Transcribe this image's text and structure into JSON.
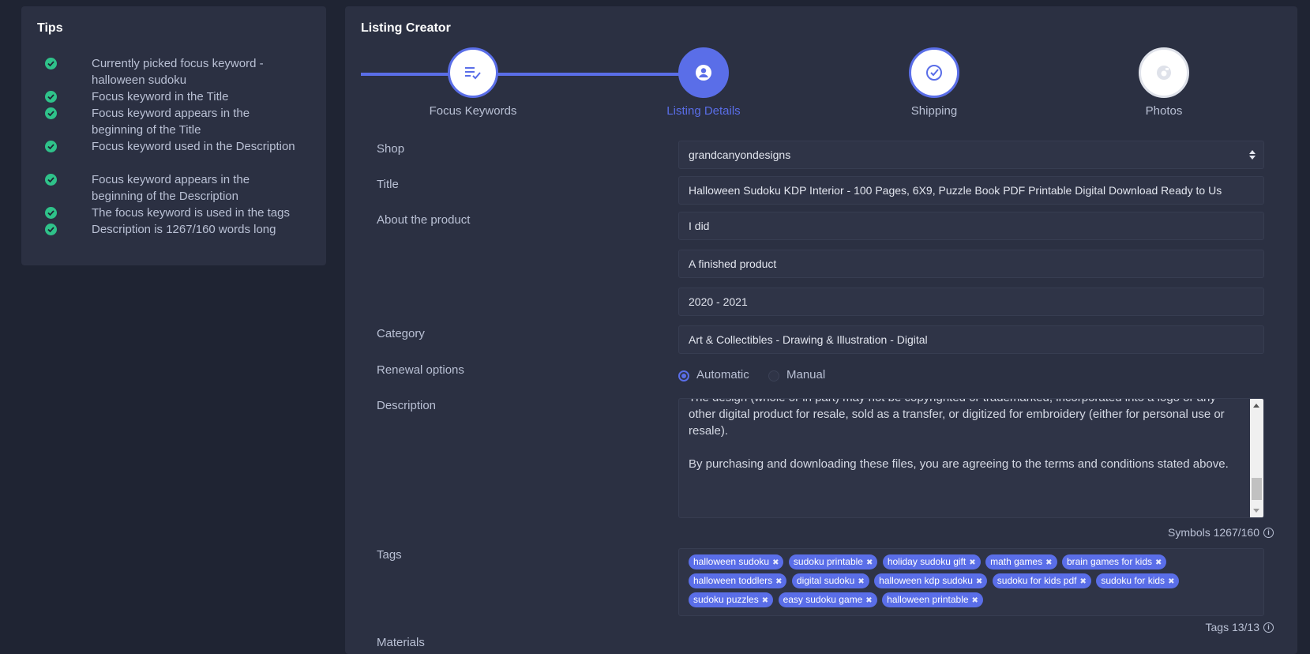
{
  "tips": {
    "title": "Tips",
    "items": [
      {
        "text": "Currently picked focus keyword - halloween sudoku",
        "status": "done"
      },
      {
        "text": "Focus keyword in the Title",
        "status": "done"
      },
      {
        "text": "Focus keyword appears in the beginning of the Title",
        "status": "done"
      },
      {
        "text": "Focus keyword used in the Description",
        "status": "done"
      },
      {
        "text": "Focus keyword appears in the beginning of the Description",
        "status": "done"
      },
      {
        "text": "The focus keyword is used in the tags",
        "status": "done"
      },
      {
        "text": "Description is 1267/160 words long",
        "status": "done"
      }
    ]
  },
  "listing": {
    "title": "Listing Creator",
    "steps": [
      {
        "label": "Focus Keywords",
        "icon": "list-check-icon",
        "state": "completed"
      },
      {
        "label": "Listing Details",
        "icon": "user-circle-icon",
        "state": "active"
      },
      {
        "label": "Shipping",
        "icon": "check-circle-icon",
        "state": "upcoming"
      },
      {
        "label": "Photos",
        "icon": "camera-icon",
        "state": "upcoming"
      }
    ],
    "fields": {
      "shop": {
        "label": "Shop",
        "value": "grandcanyondesigns"
      },
      "title": {
        "label": "Title",
        "value": "Halloween Sudoku KDP Interior - 100 Pages, 6X9, Puzzle Book PDF Printable Digital Download Ready to Us"
      },
      "about": {
        "label": "About the product",
        "who": "I did",
        "what": "A finished product",
        "when": "2020 - 2021"
      },
      "category": {
        "label": "Category",
        "value": "Art & Collectibles - Drawing & Illustration - Digital"
      },
      "renewal": {
        "label": "Renewal options",
        "options": [
          "Automatic",
          "Manual"
        ],
        "selected": "Automatic"
      },
      "description": {
        "label": "Description",
        "paragraphs": [
          "The design (whole or in part) may not be copyrighted or trademarked, incorporated into a logo or any other digital product for resale, sold as a transfer, or digitized for embroidery (either for personal use or resale).",
          "By purchasing and downloading these files, you are agreeing to the terms and conditions stated above."
        ],
        "counter": "Symbols 1267/160"
      },
      "tags": {
        "label": "Tags",
        "rows": [
          [
            "halloween sudoku",
            "sudoku printable",
            "holiday sudoku gift",
            "math games",
            "brain games for kids"
          ],
          [
            "halloween toddlers",
            "digital sudoku",
            "halloween kdp sudoku",
            "sudoku for kids pdf",
            "sudoku for kids"
          ],
          [
            "sudoku puzzles",
            "easy sudoku game",
            "halloween printable"
          ]
        ],
        "counter": "Tags 13/13"
      },
      "materials": {
        "label": "Materials"
      }
    }
  },
  "colors": {
    "accent": "#5a6ee8",
    "success": "#2fc28a",
    "panel": "#2b3042",
    "background": "#1f2433"
  }
}
